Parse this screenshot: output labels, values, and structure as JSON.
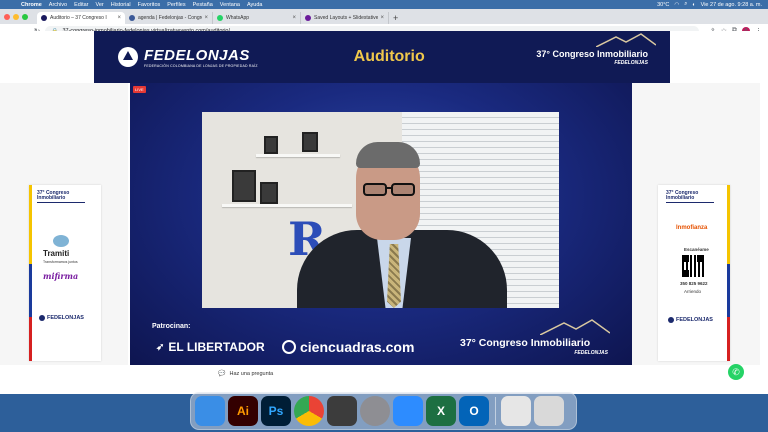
{
  "menubar": {
    "items": [
      "Chrome",
      "Archivo",
      "Editar",
      "Ver",
      "Historial",
      "Favoritos",
      "Perfiles",
      "Pestaña",
      "Ventana",
      "Ayuda"
    ],
    "temp": "30°C",
    "clock": "Vie 27 de ago.  9:28 a. m."
  },
  "tabs": [
    {
      "title": "Auditorio – 37 Congreso I",
      "color": "#1a1a5e",
      "active": true
    },
    {
      "title": "agenda | Fedelonjas - Congre",
      "color": "#3b5998",
      "active": false
    },
    {
      "title": "WhatsApp",
      "color": "#25d366",
      "active": false
    },
    {
      "title": "Saved Layouts + Slidestatives",
      "color": "#6a1b9a",
      "active": false
    }
  ],
  "address": {
    "url": "37-congreso-inmobiliario-fedelonjas.virtualizatuevento.com/auditorio/"
  },
  "avatar_letter": "A",
  "banner": {
    "brand": "FEDELONJAS",
    "brand_sub": "FEDERACIÓN COLOMBIANA DE LONJAS DE PROPIEDAD RAÍZ",
    "title": "Auditorio",
    "congreso": "37° Congreso Inmobiliario",
    "congreso_sub": "FEDELONJAS"
  },
  "left_panel": {
    "congreso": "37° Congreso",
    "congreso2": "Inmobiliario",
    "tramiti": "Tramiti",
    "tramiti_sub": "Transformamos juntos",
    "mifirma": "mifirma",
    "fedelonjas": "FEDELONJAS"
  },
  "right_panel": {
    "congreso": "37° Congreso",
    "congreso2": "Inmobiliario",
    "inmofianza": "Inmofianza",
    "escaneame": "Escanéame",
    "phone": "350 825 9622",
    "arriendo": "Arriendo",
    "fedelonjas": "FEDELONJAS"
  },
  "stage": {
    "live": "LIVE",
    "sponsors_label": "Patrocinan:",
    "sponsor1": "EL LIBERTADOR",
    "sponsor2": "ciencuadras.com",
    "congreso": "37° Congreso Inmobiliario",
    "congreso_sub": "FEDELONJAS"
  },
  "question": {
    "label": "Haz una pregunta"
  },
  "dock": [
    {
      "name": "finder",
      "label": "",
      "color": "#3a8ee6"
    },
    {
      "name": "illustrator",
      "label": "Ai",
      "color": "#330000"
    },
    {
      "name": "photoshop",
      "label": "Ps",
      "color": "#001e36"
    },
    {
      "name": "chrome",
      "label": "",
      "color": "#ffffff"
    },
    {
      "name": "inkscape",
      "label": "",
      "color": "#3c3c3c"
    },
    {
      "name": "system-preferences",
      "label": "",
      "color": "#8e8e93"
    },
    {
      "name": "zoom",
      "label": "",
      "color": "#2d8cff"
    },
    {
      "name": "excel",
      "label": "X",
      "color": "#1d6f42"
    },
    {
      "name": "outlook",
      "label": "O",
      "color": "#0364b8"
    },
    {
      "name": "documents",
      "label": "",
      "color": "#e6e6e6"
    },
    {
      "name": "trash",
      "label": "",
      "color": "#d9d9d9"
    }
  ]
}
